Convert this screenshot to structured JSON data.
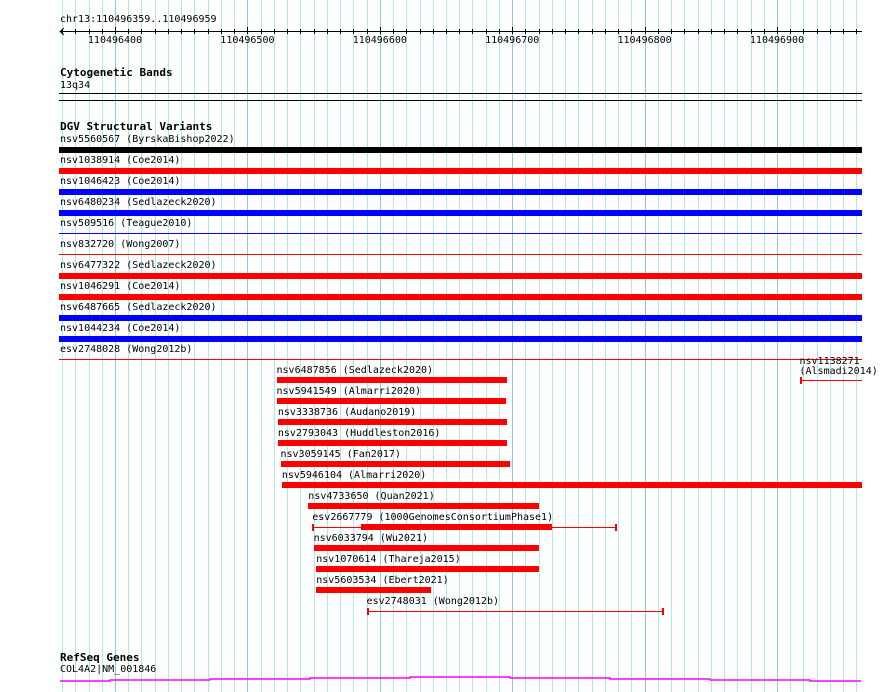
{
  "ruler": {
    "location": "chr13:110496359..110496959",
    "ticks": [
      "110496400",
      "110496500",
      "110496600",
      "110496700",
      "110496800",
      "110496900"
    ],
    "tick_positions": [
      110496400,
      110496500,
      110496600,
      110496700,
      110496800,
      110496900
    ]
  },
  "cytoband": {
    "title": "Cytogenetic Bands",
    "band": "13q34"
  },
  "dgv": {
    "title": "DGV Structural Variants",
    "colors": {
      "red": "#ff0000",
      "blue": "#0000ff",
      "black": "#000000"
    },
    "rows": [
      {
        "label": "nsv5560567 (ByrskaBishop2022)",
        "color": "black",
        "style": "thick"
      },
      {
        "label": "nsv1038914 (Coe2014)",
        "color": "red",
        "style": "thick"
      },
      {
        "label": "nsv1046423 (Coe2014)",
        "color": "blue",
        "style": "thick"
      },
      {
        "label": "nsv6480234 (Sedlazeck2020)",
        "color": "blue",
        "style": "thick"
      },
      {
        "label": "nsv509516 (Teague2010)",
        "color": "blue",
        "style": "thin"
      },
      {
        "label": "nsv832720 (Wong2007)",
        "color": "red",
        "style": "thin"
      },
      {
        "label": "nsv6477322 (Sedlazeck2020)",
        "color": "red",
        "style": "thick"
      },
      {
        "label": "nsv1046291 (Coe2014)",
        "color": "red",
        "style": "thick"
      },
      {
        "label": "nsv6487665 (Sedlazeck2020)",
        "color": "blue",
        "style": "thick"
      },
      {
        "label": "nsv1044234 (Coe2014)",
        "color": "blue",
        "style": "thick"
      },
      {
        "label": "esv2748028 (Wong2012b)",
        "color": "red",
        "style": "thin"
      }
    ],
    "stacked": [
      {
        "label": "nsv6487856 (Sedlazeck2020)",
        "row": 0,
        "start": 110496522,
        "end": 110496696,
        "style": "thick"
      },
      {
        "label": "nsv1138271 (Alsmadi2014)",
        "row": 0,
        "start": 110496917,
        "end": 110497000,
        "style": "thin"
      },
      {
        "label": "nsv5941549 (Almarri2020)",
        "row": 1,
        "start": 110496522,
        "end": 110496695,
        "style": "thick"
      },
      {
        "label": "nsv3338736 (Audano2019)",
        "row": 2,
        "start": 110496523,
        "end": 110496696,
        "style": "thick"
      },
      {
        "label": "nsv2793043 (Huddleston2016)",
        "row": 3,
        "start": 110496523,
        "end": 110496696,
        "style": "thick"
      },
      {
        "label": "nsv3059145 (Fan2017)",
        "row": 4,
        "start": 110496525,
        "end": 110496698,
        "style": "thick"
      },
      {
        "label": "nsv5946104 (Almarri2020)",
        "row": 5,
        "start": 110496526,
        "end": 110497000,
        "style": "thick"
      },
      {
        "label": "nsv4733650 (Quan2021)",
        "row": 6,
        "start": 110496546,
        "end": 110496720,
        "style": "thick"
      },
      {
        "label": "esv2667779 (1000GenomesConsortiumPhase1)",
        "row": 7,
        "start": 110496549,
        "end": 110496779,
        "thick_start": 110496586,
        "thick_end": 110496730,
        "style": "mixed"
      },
      {
        "label": "nsv6033794 (Wu2021)",
        "row": 8,
        "start": 110496550,
        "end": 110496720,
        "style": "thick"
      },
      {
        "label": "nsv1070614 (Thareja2015)",
        "row": 9,
        "start": 110496552,
        "end": 110496720,
        "style": "thick"
      },
      {
        "label": "nsv5603534 (Ebert2021)",
        "row": 10,
        "start": 110496552,
        "end": 110496639,
        "style": "thick"
      },
      {
        "label": "esv2748031 (Wong2012b)",
        "row": 11,
        "start": 110496590,
        "end": 110496815,
        "style": "thin"
      }
    ]
  },
  "refseq": {
    "title": "RefSeq Genes",
    "gene": "COL4A2|NM_001846",
    "color": "#ff00ff"
  }
}
